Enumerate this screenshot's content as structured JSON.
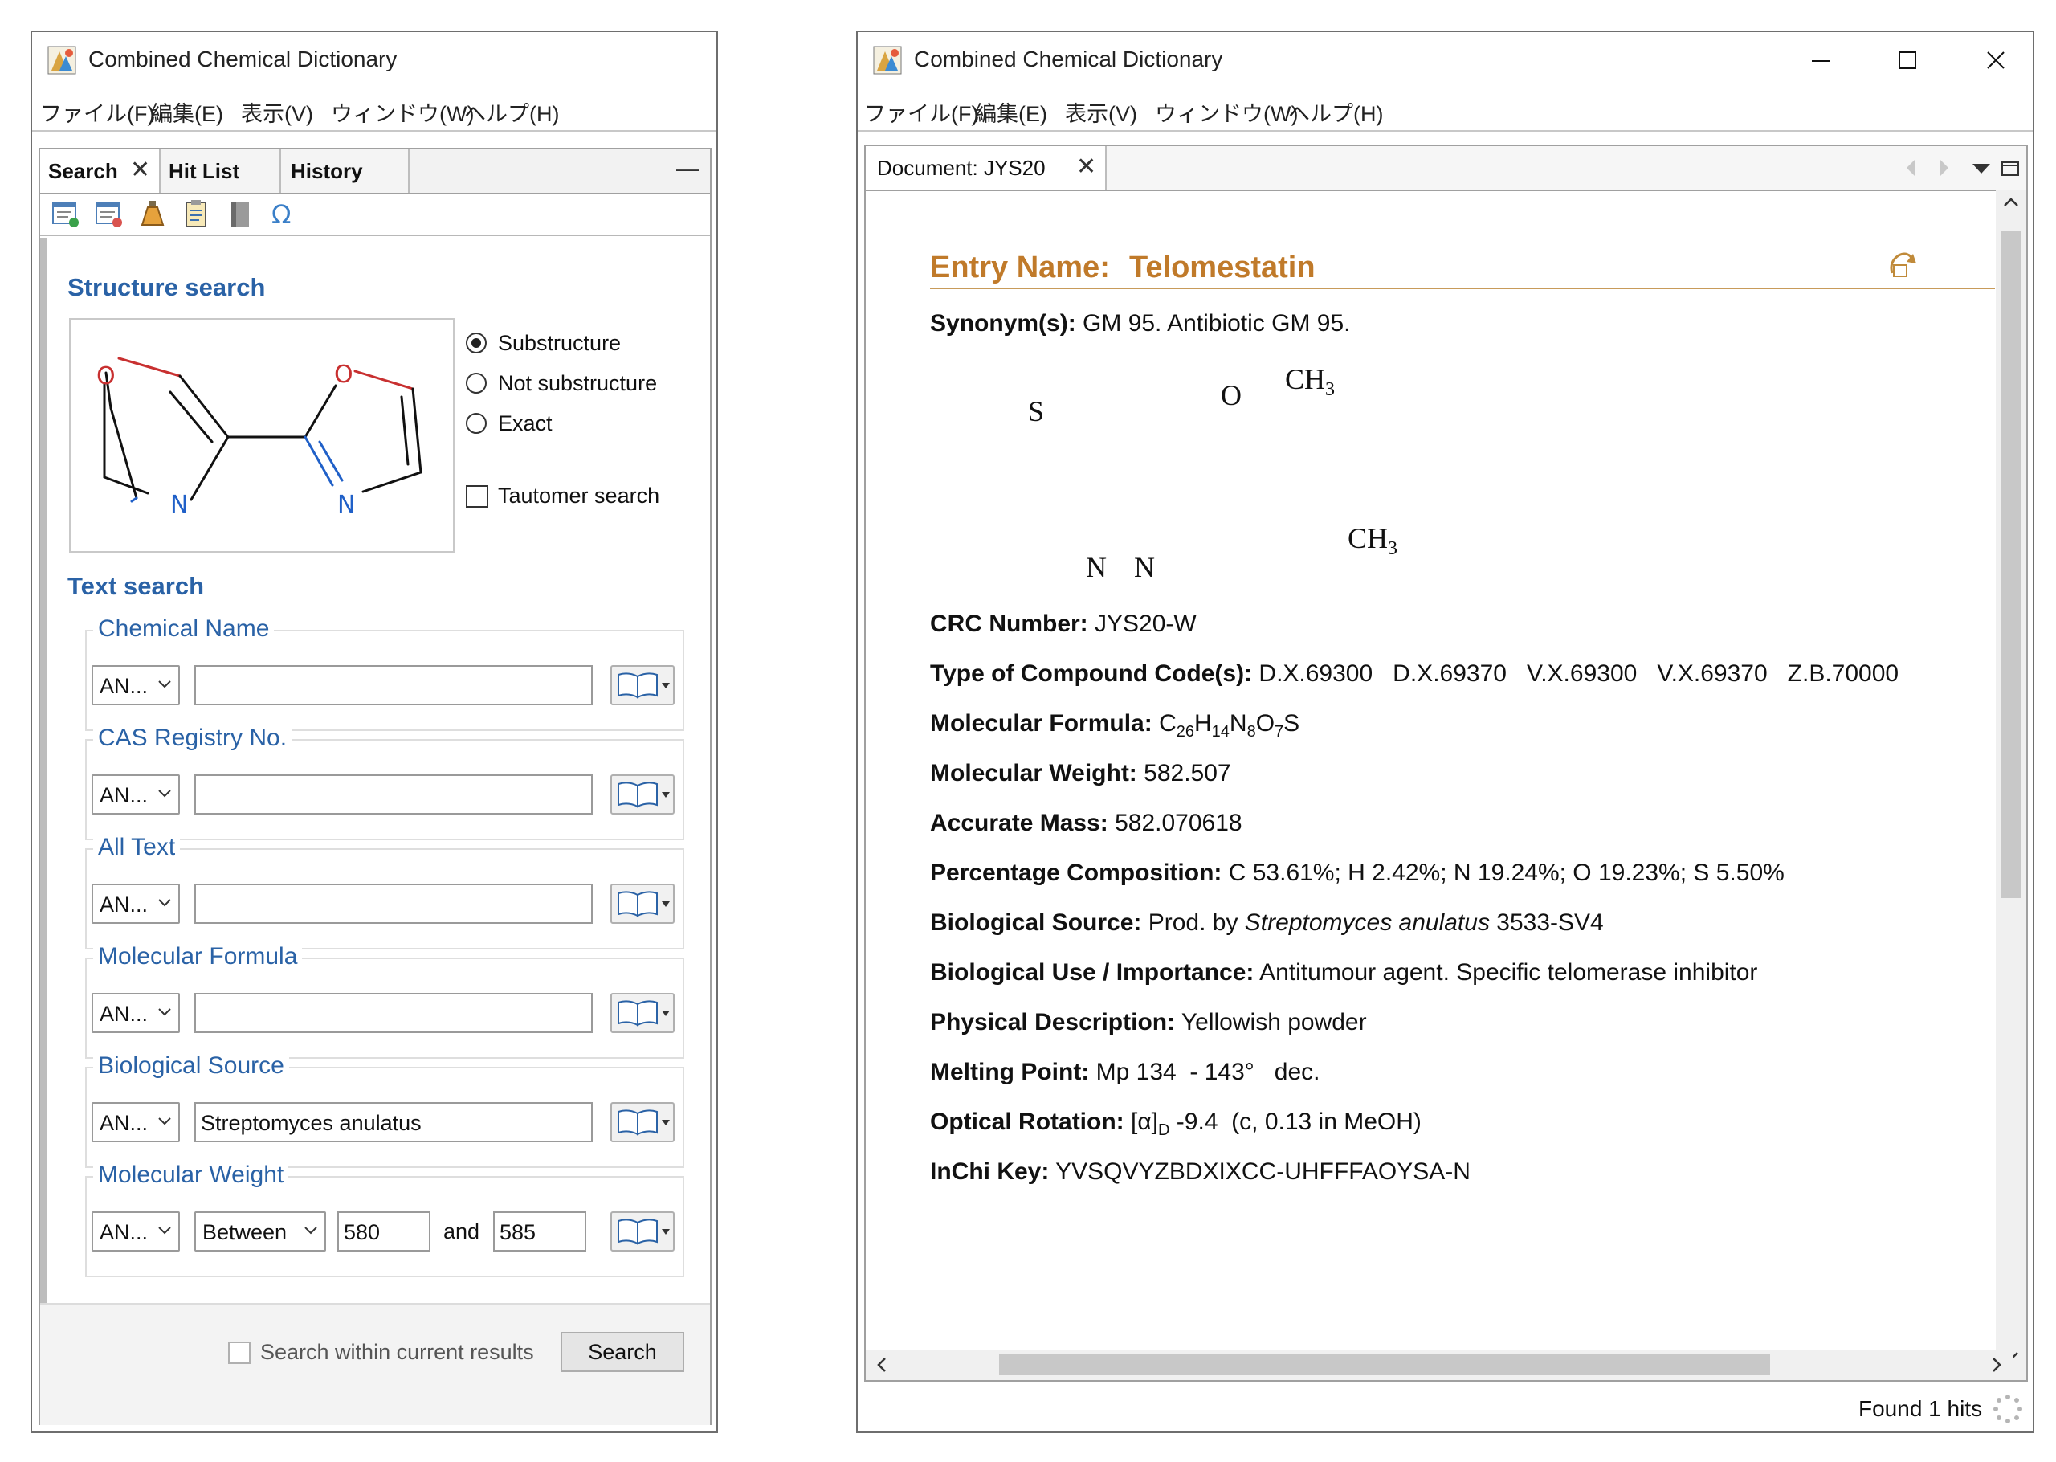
{
  "left_window": {
    "title": "Combined Chemical Dictionary",
    "menu": [
      "ファイル(F)",
      "編集(E)",
      "表示(V)",
      "ウィンドウ(W)",
      "ヘルプ(H)"
    ],
    "tabs": [
      {
        "label": "Search",
        "close": "✕"
      },
      {
        "label": "Hit List"
      },
      {
        "label": "History"
      }
    ],
    "minimize_glyph": "—",
    "structure_search": {
      "title": "Structure search",
      "options": [
        "Substructure",
        "Not substructure",
        "Exact"
      ],
      "selected_option": "Substructure",
      "tautomer_label": "Tautomer search",
      "atoms": {
        "o_left": "O",
        "n_left": "N",
        "o_right": "O",
        "n_right": "N"
      }
    },
    "text_search": {
      "title": "Text search",
      "fields": [
        {
          "label": "Chemical Name",
          "operator": "AN...",
          "value": ""
        },
        {
          "label": "CAS Registry No.",
          "operator": "AN...",
          "value": ""
        },
        {
          "label": "All Text",
          "operator": "AN...",
          "value": ""
        },
        {
          "label": "Molecular Formula",
          "operator": "AN...",
          "value": ""
        },
        {
          "label": "Biological Source",
          "operator": "AN...",
          "value": "Streptomyces anulatus"
        }
      ],
      "molecular_weight": {
        "label": "Molecular Weight",
        "operator": "AN...",
        "range_mode": "Between",
        "from": "580",
        "and_label": "and",
        "to": "585"
      }
    },
    "footer": {
      "within_results_label": "Search within current results",
      "search_button": "Search"
    }
  },
  "right_window": {
    "title": "Combined Chemical Dictionary",
    "menu": [
      "ファイル(F)",
      "編集(E)",
      "表示(V)",
      "ウィンドウ(W)",
      "ヘルプ(H)"
    ],
    "document_tab": {
      "label": "Document: JYS20",
      "close": "✕"
    },
    "entry": {
      "name_label": "Entry Name:",
      "name_value": "Telomestatin",
      "synonyms": {
        "key": "Synonym(s):",
        "value": "GM 95. Antibiotic GM 95."
      },
      "structure_labels": {
        "ch3": "CH",
        "sub3": "3",
        "s": "S",
        "o": "O",
        "n": "N"
      },
      "crc_number": {
        "key": "CRC Number:",
        "value": "JYS20-W"
      },
      "compound_type": {
        "key": "Type of Compound Code(s):",
        "value": "D.X.69300   D.X.69370   V.X.69300   V.X.69370   Z.B.70000"
      },
      "formula": {
        "key": "Molecular Formula:",
        "c": "C",
        "c_n": "26",
        "h": "H",
        "h_n": "14",
        "n": "N",
        "n_n": "8",
        "o": "O",
        "o_n": "7",
        "s": "S"
      },
      "weight": {
        "key": "Molecular Weight:",
        "value": "582.507"
      },
      "accurate_mass": {
        "key": "Accurate Mass:",
        "value": "582.070618"
      },
      "composition": {
        "key": "Percentage Composition:",
        "value": "C 53.61%; H 2.42%; N 19.24%; O 19.23%; S 5.50%"
      },
      "bio_source": {
        "key": "Biological Source:",
        "prefix": "Prod. by ",
        "species": "Streptomyces anulatus",
        "suffix": " 3533-SV4"
      },
      "bio_use": {
        "key": "Biological Use / Importance:",
        "value": "Antitumour agent. Specific telomerase inhibitor"
      },
      "physical": {
        "key": "Physical Description:",
        "value": "Yellowish powder"
      },
      "melting_point": {
        "key": "Melting Point:",
        "value": "Mp 134  - 143°   dec."
      },
      "optical_rotation": {
        "key": "Optical Rotation:",
        "alpha": "[α]",
        "sub": "D",
        "value": " -9.4  (c, 0.13 in MeOH)"
      },
      "inchi_key": {
        "key": "InChi Key:",
        "value": "YVSQVYZBDXIXCC-UHFFFAOYSA-N"
      }
    },
    "status": "Found 1 hits"
  }
}
